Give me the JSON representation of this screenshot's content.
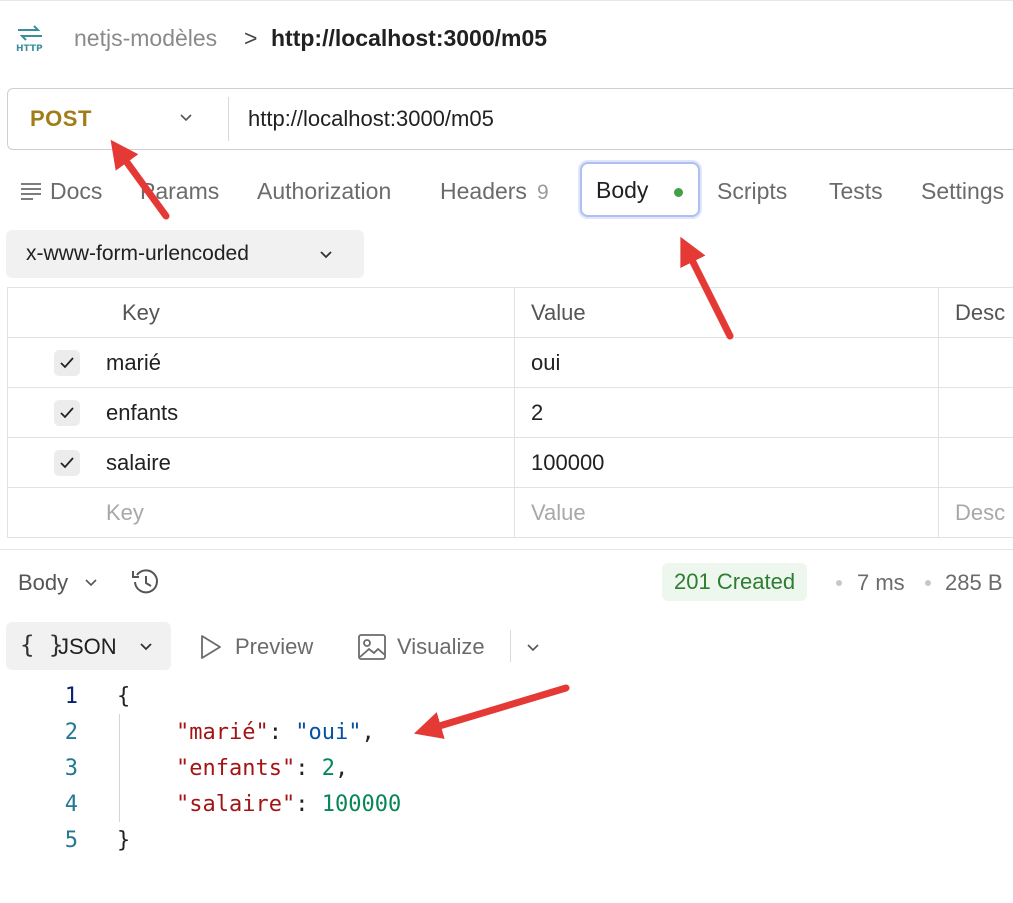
{
  "breadcrumb": {
    "icon": "http-icon",
    "parent": "netjs-modèles",
    "separator": ">",
    "current": "http://localhost:3000/m05"
  },
  "request": {
    "method": "POST",
    "url": "http://localhost:3000/m05"
  },
  "tabs": {
    "docs": "Docs",
    "params": "Params",
    "authorization": "Authorization",
    "headers": "Headers",
    "headers_count": "9",
    "body": "Body",
    "scripts": "Scripts",
    "tests": "Tests",
    "settings": "Settings"
  },
  "body_type": "x-www-form-urlencoded",
  "params_table": {
    "headers": {
      "key": "Key",
      "value": "Value",
      "description": "Desc"
    },
    "rows": [
      {
        "key": "marié",
        "value": "oui",
        "checked": true
      },
      {
        "key": "enfants",
        "value": "2",
        "checked": true
      },
      {
        "key": "salaire",
        "value": "100000",
        "checked": true
      }
    ],
    "placeholders": {
      "key": "Key",
      "value": "Value",
      "description": "Desc"
    }
  },
  "response": {
    "body_label": "Body",
    "status": "201 Created",
    "time": "7 ms",
    "size": "285 B",
    "view": {
      "format": "JSON",
      "format_braces": "{ }",
      "preview": "Preview",
      "visualize": "Visualize"
    },
    "code_lines": [
      {
        "n": "1",
        "open": "{"
      },
      {
        "n": "2",
        "key": "\"marié\"",
        "colon": ": ",
        "value": "\"oui\"",
        "comma": ","
      },
      {
        "n": "3",
        "key": "\"enfants\"",
        "colon": ": ",
        "value": "2",
        "comma": ","
      },
      {
        "n": "4",
        "key": "\"salaire\"",
        "colon": ": ",
        "value": "100000",
        "comma": ""
      },
      {
        "n": "5",
        "close": "}"
      }
    ]
  },
  "colors": {
    "method": "#a07d17",
    "status_text": "#2e7d32",
    "status_bg": "#eef7ee",
    "body_dot": "#43a047",
    "active_tab_border": "#aebff0",
    "arrow": "#e53935",
    "json_key": "#a31515",
    "json_string": "#0451a5",
    "json_number": "#098658"
  }
}
